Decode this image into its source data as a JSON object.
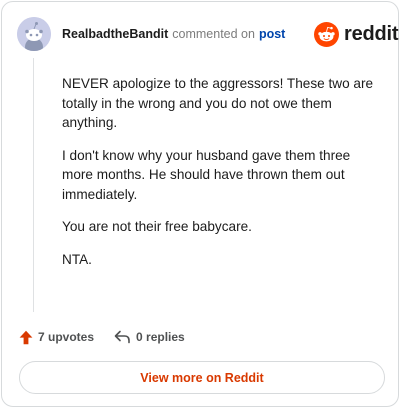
{
  "header": {
    "username": "RealbadtheBandit",
    "action_text": "commented on",
    "post_link": "post"
  },
  "brand": {
    "name": "reddit",
    "logo_icon": "reddit-alien-icon",
    "accent_color": "#ff4500"
  },
  "comment": {
    "paragraphs": [
      "NEVER apologize to the aggressors! These two are totally in the wrong and you do not owe them anything.",
      "I don't know why your husband gave them three more months. He should have thrown them out immediately.",
      "You are not their free babycare.",
      "NTA."
    ]
  },
  "actions": {
    "upvotes": "7 upvotes",
    "upvote_icon": "upvote-arrow-icon",
    "replies": "0 replies",
    "reply_icon": "reply-icon"
  },
  "footer": {
    "view_more_label": "View more on Reddit"
  }
}
